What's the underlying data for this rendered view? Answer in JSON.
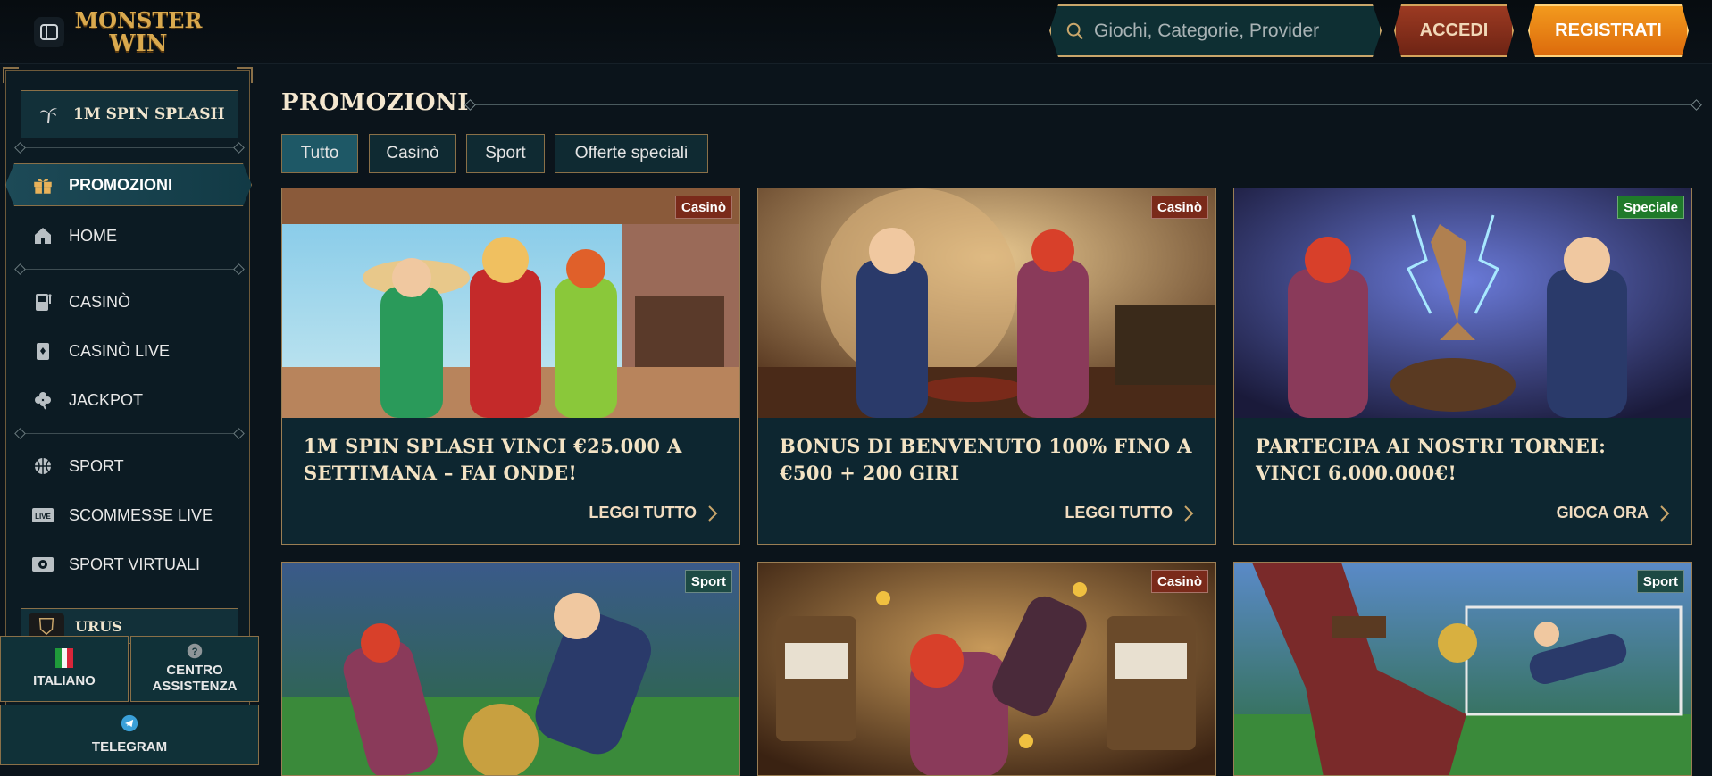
{
  "header": {
    "logo_line1": "MONSTER",
    "logo_line2": "WIN",
    "search_placeholder": "Giochi, Categorie, Provider",
    "login_label": "ACCEDI",
    "register_label": "REGISTRATI"
  },
  "sidebar": {
    "promo_banner": "1M SPIN SPLASH",
    "active_item": "PROMOZIONI",
    "items": [
      {
        "label": "HOME",
        "icon": "home-icon"
      },
      {
        "label": "CASINÒ",
        "icon": "slot-machine-icon"
      },
      {
        "label": "CASINÒ LIVE",
        "icon": "cards-icon"
      },
      {
        "label": "JACKPOT",
        "icon": "clover-icon"
      },
      {
        "label": "SPORT",
        "icon": "basketball-icon"
      },
      {
        "label": "SCOMMESSE LIVE",
        "icon": "live-icon"
      },
      {
        "label": "SPORT VIRTUALI",
        "icon": "virtual-sport-icon"
      }
    ],
    "urus_label": "URUS",
    "language_label": "ITALIANO",
    "support_label_line1": "CENTRO",
    "support_label_line2": "ASSISTENZA",
    "telegram_label": "TELEGRAM"
  },
  "main": {
    "title": "PROMOZIONI",
    "tabs": [
      "Tutto",
      "Casinò",
      "Sport",
      "Offerte speciali"
    ],
    "cards": [
      {
        "tag": "Casinò",
        "tag_color": "#7a2a1a",
        "title": "1M SPIN SPLASH VINCI €25.000 A SETTIMANA – FAI ONDE!",
        "cta": "LEGGI TUTTO"
      },
      {
        "tag": "Casinò",
        "tag_color": "#7a2a1a",
        "title": "BONUS DI BENVENUTO 100% FINO A €500 + 200 GIRI",
        "cta": "LEGGI TUTTO"
      },
      {
        "tag": "Speciale",
        "tag_color": "#1f7a2a",
        "title": "PARTECIPA AI NOSTRI TORNEI: VINCI 6.000.000€!",
        "cta": "GIOCA ORA"
      },
      {
        "tag": "Sport",
        "tag_color": "#1d4a44"
      },
      {
        "tag": "Casinò",
        "tag_color": "#7a2a1a"
      },
      {
        "tag": "Sport",
        "tag_color": "#1d4a44"
      }
    ]
  }
}
